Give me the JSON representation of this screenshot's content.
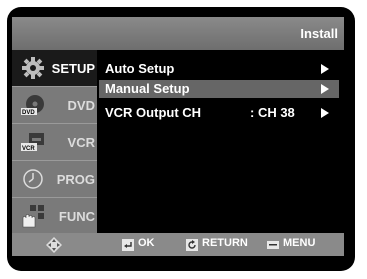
{
  "header": {
    "title": "Install"
  },
  "sidebar": {
    "items": [
      {
        "label": "SETUP",
        "icon": "gear-icon",
        "active": true
      },
      {
        "label": "DVD",
        "icon": "dvd-disc-icon",
        "active": false
      },
      {
        "label": "VCR",
        "icon": "vcr-cassette-icon",
        "active": false
      },
      {
        "label": "PROG",
        "icon": "clock-icon",
        "active": false
      },
      {
        "label": "FUNC",
        "icon": "grid-hand-icon",
        "active": false
      }
    ]
  },
  "menu": {
    "items": [
      {
        "label": "Auto Setup",
        "value": "",
        "selected": false
      },
      {
        "label": "Manual Setup",
        "value": "",
        "selected": true
      },
      {
        "label": "VCR Output CH",
        "value": ": CH 38",
        "selected": false
      }
    ]
  },
  "footer": {
    "nav_icon": "directional-pad-icon",
    "ok_label": "OK",
    "return_label": "RETURN",
    "menu_label": "MENU"
  },
  "colors": {
    "screen": "#000000",
    "header": "#7c7c7c",
    "sidebar": "#7a7a7a",
    "selected_row": "#666666",
    "text": "#ffffff"
  }
}
